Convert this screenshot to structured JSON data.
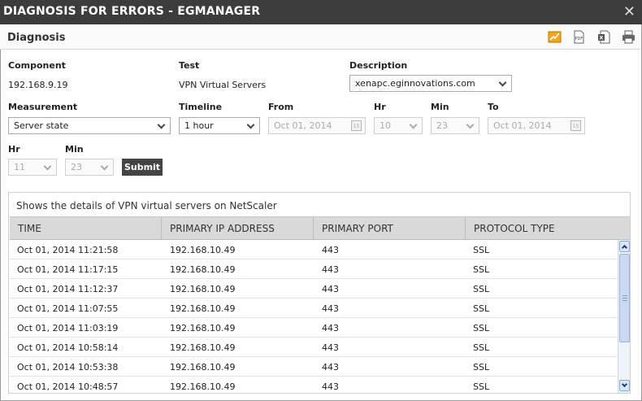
{
  "window": {
    "title": "DIAGNOSIS FOR ERRORS - EGMANAGER",
    "close_label": "✕"
  },
  "panel": {
    "title": "Diagnosis",
    "tools": [
      "chart-icon",
      "pdf-icon",
      "excel-icon",
      "print-icon"
    ]
  },
  "form": {
    "component": {
      "label": "Component",
      "value": "192.168.9.19"
    },
    "test": {
      "label": "Test",
      "value": "VPN Virtual Servers"
    },
    "description": {
      "label": "Description",
      "value": "xenapc.eginnovations.com"
    },
    "measurement": {
      "label": "Measurement",
      "value": "Server state"
    },
    "timeline": {
      "label": "Timeline",
      "value": "1 hour"
    },
    "from": {
      "label": "From",
      "date": "Oct 01, 2014",
      "hr_label": "Hr",
      "hr": "10",
      "min_label": "Min",
      "min": "23"
    },
    "to": {
      "label": "To",
      "date": "Oct 01, 2014",
      "hr_label": "Hr",
      "hr": "11",
      "min_label": "Min",
      "min": "23"
    },
    "submit_label": "Submit",
    "calendar_glyph": "15"
  },
  "results": {
    "caption": "Shows the details of VPN virtual servers on NetScaler",
    "columns": [
      "TIME",
      "PRIMARY IP ADDRESS",
      "PRIMARY PORT",
      "PROTOCOL TYPE"
    ],
    "rows": [
      [
        "Oct 01, 2014 11:21:58",
        "192.168.10.49",
        "443",
        "SSL"
      ],
      [
        "Oct 01, 2014 11:17:15",
        "192.168.10.49",
        "443",
        "SSL"
      ],
      [
        "Oct 01, 2014 11:12:37",
        "192.168.10.49",
        "443",
        "SSL"
      ],
      [
        "Oct 01, 2014 11:07:55",
        "192.168.10.49",
        "443",
        "SSL"
      ],
      [
        "Oct 01, 2014 11:03:19",
        "192.168.10.49",
        "443",
        "SSL"
      ],
      [
        "Oct 01, 2014 10:58:14",
        "192.168.10.49",
        "443",
        "SSL"
      ],
      [
        "Oct 01, 2014 10:53:38",
        "192.168.10.49",
        "443",
        "SSL"
      ],
      [
        "Oct 01, 2014 10:48:57",
        "192.168.10.49",
        "443",
        "SSL"
      ]
    ]
  },
  "colors": {
    "titlebar": "#3c3c3c",
    "header_row": "#d9d9d9",
    "submit": "#444444",
    "chart_icon": "#f2a71b"
  }
}
